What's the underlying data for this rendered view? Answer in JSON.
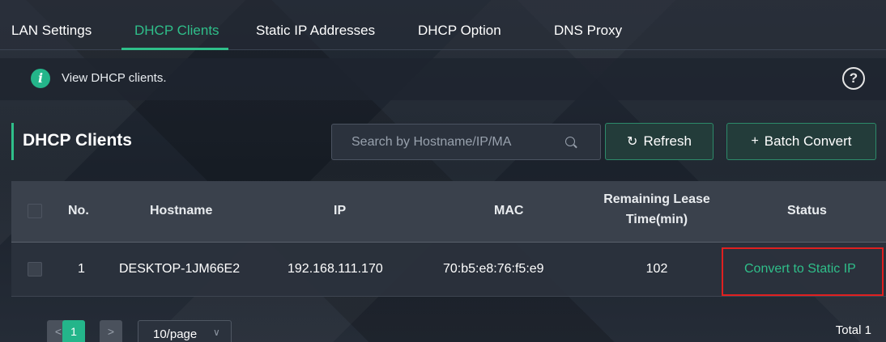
{
  "tabs": [
    {
      "label": "LAN Settings",
      "active": false
    },
    {
      "label": "DHCP Clients",
      "active": true
    },
    {
      "label": "Static IP Addresses",
      "active": false
    },
    {
      "label": "DHCP Option",
      "active": false
    },
    {
      "label": "DNS Proxy",
      "active": false
    }
  ],
  "info": {
    "text": "View DHCP clients.",
    "icon": "info-icon",
    "help_icon": "help-circle-icon",
    "help_glyph": "?"
  },
  "section": {
    "title": "DHCP Clients"
  },
  "search": {
    "placeholder": "Search by Hostname/IP/MA",
    "value": ""
  },
  "toolbar": {
    "refresh_label": "Refresh",
    "refresh_icon": "↻",
    "batch_label": "Batch Convert",
    "batch_icon": "+"
  },
  "table": {
    "columns": [
      "No.",
      "Hostname",
      "IP",
      "MAC",
      "Remaining Lease",
      "Time(min)",
      "Status"
    ],
    "rows": [
      {
        "no": "1",
        "hostname": "DESKTOP-1JM66E2",
        "ip": "192.168.111.170",
        "mac": "70:b5:e8:76:f5:e9",
        "lease": "102",
        "status": "Convert to Static IP"
      }
    ]
  },
  "pagination": {
    "prev": "<",
    "current": "1",
    "next": ">",
    "page_size": "10/page",
    "page_size_chev": "∨",
    "total": "Total 1"
  },
  "colors": {
    "accent": "#2fbf8a",
    "highlight": "#e02020"
  }
}
